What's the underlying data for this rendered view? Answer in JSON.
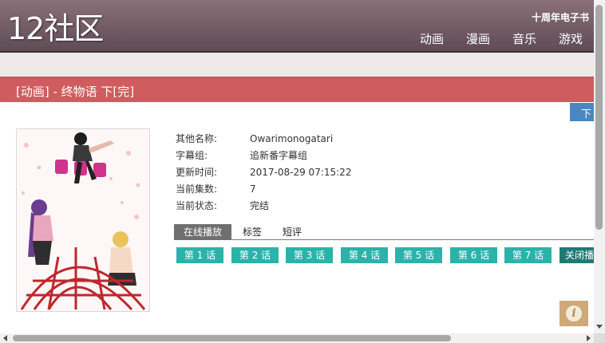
{
  "header": {
    "logo": "12社区",
    "top_link": "十周年电子书",
    "nav": [
      "动画",
      "漫画",
      "音乐",
      "游戏"
    ]
  },
  "title_bar": {
    "title": "[动画] - 终物语 下[完]"
  },
  "download_button": {
    "label": "下"
  },
  "cover": {
    "alt": "终物语"
  },
  "info": [
    {
      "key": "其他名称:",
      "value": "Owarimonogatari"
    },
    {
      "key": "字幕组:",
      "value": "追新番字幕组"
    },
    {
      "key": "更新时间:",
      "value": "2017-08-29 07:15:22"
    },
    {
      "key": "当前集数:",
      "value": "7"
    },
    {
      "key": "当前状态:",
      "value": "完结"
    }
  ],
  "tabs": [
    "在线播放",
    "标签",
    "短评"
  ],
  "episodes": [
    "第 1 话",
    "第 2 话",
    "第 3 话",
    "第 4 话",
    "第 5 话",
    "第 6 话",
    "第 7 话"
  ],
  "close_player": "关闭播放",
  "info_icon_glyph": "i",
  "colors": {
    "header": "#6e5a63",
    "title_bar": "#cf5c5e",
    "episode_button": "#2bb3a9",
    "close_button": "#1f7a75",
    "download_button": "#4a87c0"
  }
}
